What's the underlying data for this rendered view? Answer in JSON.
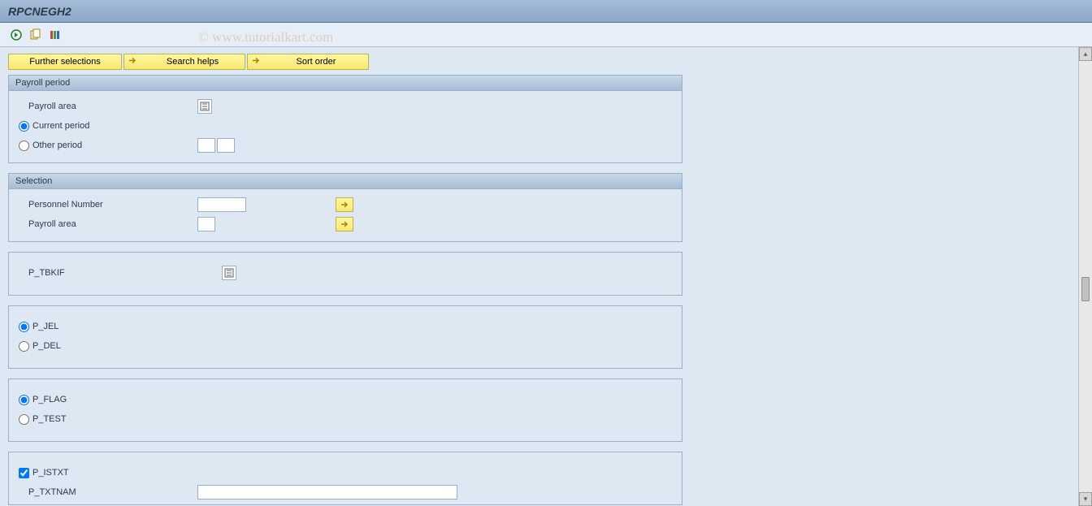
{
  "header": {
    "title": "RPCNEGH2"
  },
  "toolbar": {
    "icons": [
      "execute-icon",
      "variant-icon",
      "options-icon"
    ]
  },
  "buttons": {
    "further_selections": "Further selections",
    "search_helps": "Search helps",
    "sort_order": "Sort order"
  },
  "groups": {
    "payroll_period": {
      "title": "Payroll period",
      "payroll_area_label": "Payroll area",
      "current_period_label": "Current period",
      "other_period_label": "Other period"
    },
    "selection": {
      "title": "Selection",
      "personnel_number_label": "Personnel Number",
      "payroll_area_label": "Payroll area"
    },
    "tbkif": {
      "label": "P_TBKIF"
    },
    "jel_del": {
      "p_jel": "P_JEL",
      "p_del": "P_DEL"
    },
    "flag_test": {
      "p_flag": "P_FLAG",
      "p_test": "P_TEST"
    },
    "txt": {
      "p_istxt": "P_ISTXT",
      "p_txtnam": "P_TXTNAM"
    }
  },
  "watermark": "© www.tutorialkart.com"
}
